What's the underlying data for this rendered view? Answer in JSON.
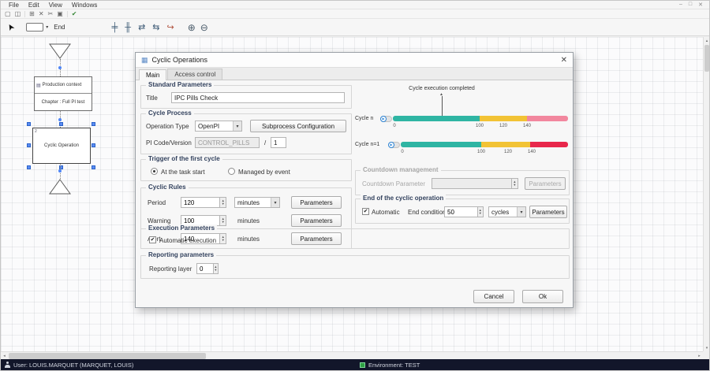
{
  "icons": {
    "caret_down": "▾",
    "spinner_up": "▲",
    "spinner_down": "▼",
    "check": "✔",
    "close": "✕",
    "play": "▶",
    "axis_arrow": "▲",
    "scroll_up": "▴",
    "scroll_down": "▾",
    "scroll_left": "◂",
    "scroll_right": "▸",
    "pointer": "➤",
    "zoom_in": "⊕",
    "zoom_out": "⊖",
    "dialog": "▦",
    "page": "▤",
    "minimize": "–",
    "maximize": "□"
  },
  "menu_bar": {
    "items": [
      "File",
      "Edit",
      "View",
      "Windows"
    ]
  },
  "toolbar_top": {
    "icons": [
      {
        "name": "new-document-icon",
        "glyph": "▢"
      },
      {
        "name": "open-window-icon",
        "glyph": "◫"
      },
      {
        "name": "print-icon",
        "glyph": "⊞"
      },
      {
        "name": "delete-icon",
        "glyph": "✕"
      },
      {
        "name": "cut-icon",
        "glyph": "✂"
      },
      {
        "name": "copy-icon",
        "glyph": "▣"
      },
      {
        "name": "validate-icon",
        "glyph": "✔"
      }
    ]
  },
  "toolbar_main": {
    "shape_tool_label": "End",
    "align_icons": [
      {
        "name": "distribute-vertical-icon",
        "glyph": "╪"
      },
      {
        "name": "junction-icon",
        "glyph": "╫"
      },
      {
        "name": "swap-horizontal-icon",
        "glyph": "⇄"
      },
      {
        "name": "swap-reverse-icon",
        "glyph": "⇆"
      },
      {
        "name": "exit-branch-icon",
        "glyph": "↪"
      }
    ]
  },
  "canvas": {
    "context_box": {
      "line1": "Production context",
      "line2": "Chapter : Full PI test"
    },
    "cyclic_box": {
      "badge": "2",
      "label": "Cyclic Operation"
    }
  },
  "dialog": {
    "title": "Cyclic Operations",
    "tabs": [
      {
        "label": "Main"
      },
      {
        "label": "Access control"
      }
    ],
    "standard_parameters": {
      "legend": "Standard Parameters",
      "title_label": "Title",
      "title_value": "IPC Pills Check"
    },
    "cycle_process": {
      "legend": "Cycle Process",
      "operation_type_label": "Operation Type",
      "operation_type_value": "OpenPI",
      "subprocess_button": "Subprocess Configuration",
      "pi_code_label": "PI Code/Version",
      "pi_code_value": "CONTROL_PILLS",
      "slash": "/",
      "pi_version_value": "1"
    },
    "trigger": {
      "legend": "Trigger of the first cycle",
      "option1": "At the task start",
      "option2": "Managed by event"
    },
    "cyclic_rules": {
      "legend": "Cyclic Rules",
      "parameters_button": "Parameters",
      "rows": [
        {
          "label": "Period",
          "value": "120",
          "unit": "minutes"
        },
        {
          "label": "Warning",
          "value": "100",
          "unit": "minutes"
        },
        {
          "label": "Alert",
          "value": "140",
          "unit": "minutes"
        }
      ]
    },
    "timeline": {
      "title": "Cycle execution completed",
      "row1": {
        "label": "Cycle n",
        "ticks": [
          "0",
          "100",
          "120",
          "140"
        ]
      },
      "row2": {
        "label": "Cycle n=1",
        "ticks": [
          "0",
          "100",
          "120",
          "140"
        ]
      },
      "colors": {
        "running": "#2fb5a3",
        "warning": "#f2c335",
        "alert_soft": "#f2879e",
        "alert_strong": "#e8274b"
      }
    },
    "countdown": {
      "legend": "Countdown management",
      "label": "Countdown Parameter",
      "value": "",
      "parameters_button": "Parameters"
    },
    "end_cycle": {
      "legend": "End of the cyclic operation",
      "automatic_label": "Automatic",
      "condition_label": "End condition",
      "condition_value": "50",
      "unit_value": "cycles",
      "parameters_button": "Parameters"
    },
    "execution": {
      "legend": "Execution Parameters",
      "automatic_label": "Automatic execution"
    },
    "reporting": {
      "legend": "Reporting parameters",
      "layer_label": "Reporting layer",
      "layer_value": "0"
    },
    "cancel_button": "Cancel",
    "ok_button": "Ok"
  },
  "status_bar": {
    "user": "User: LOUIS.MARQUET (MARQUET, LOUIS)",
    "environment": "Environment: TEST"
  }
}
